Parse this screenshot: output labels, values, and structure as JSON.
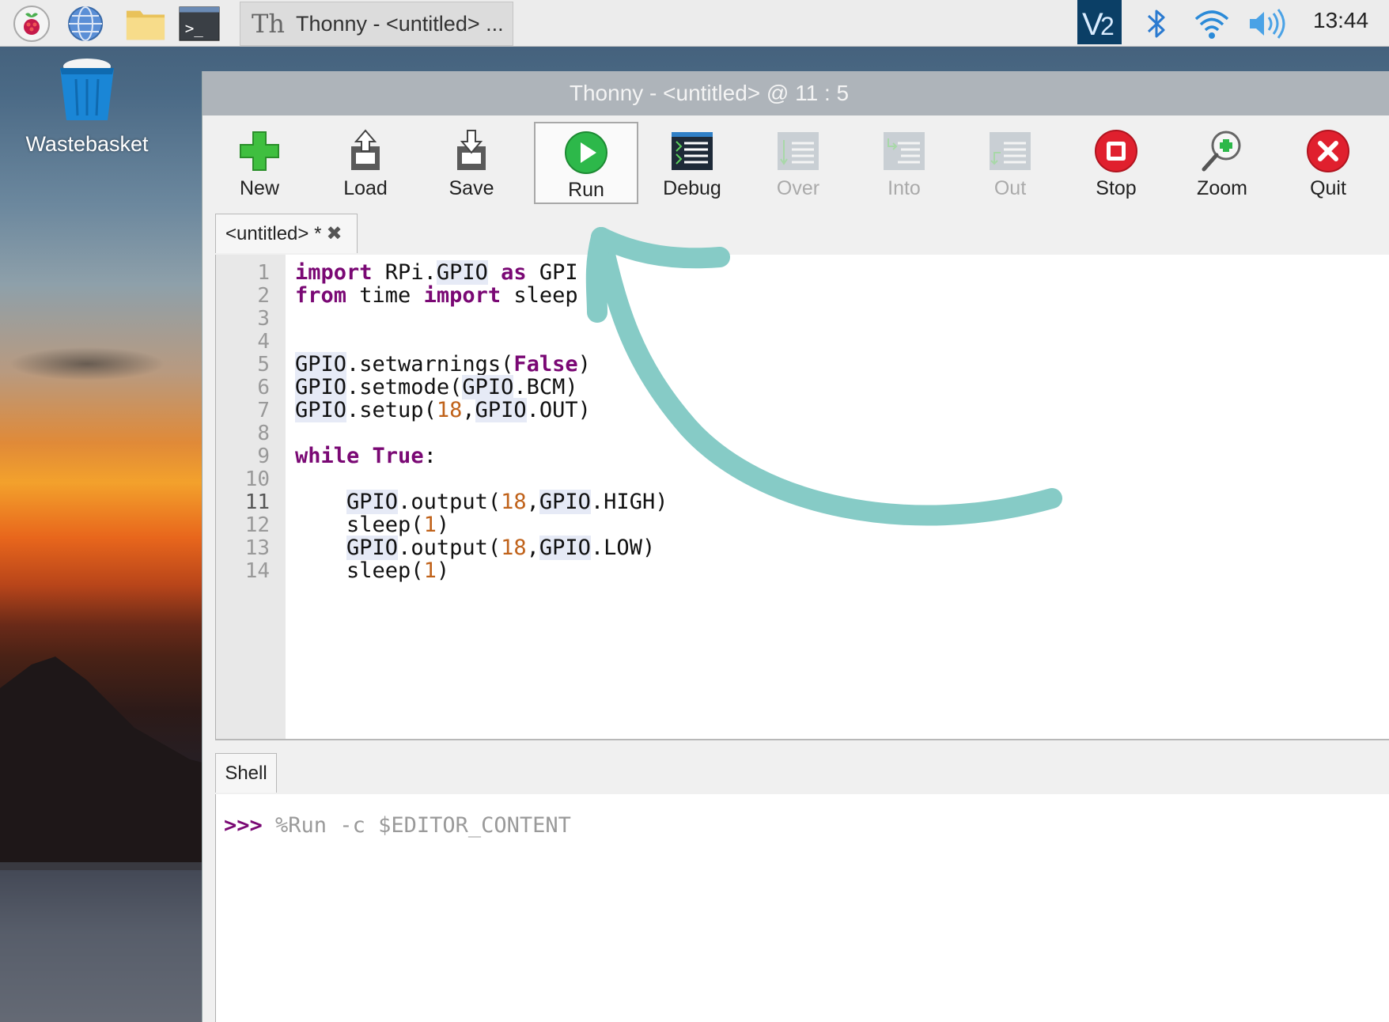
{
  "panel": {
    "task_title": "Thonny  -  <untitled>  ...",
    "clock": "13:44",
    "vnc_label": "V2"
  },
  "desktop": {
    "wastebasket_label": "Wastebasket"
  },
  "window": {
    "title": "Thonny  -  <untitled>  @  11 : 5"
  },
  "toolbar": {
    "new": "New",
    "load": "Load",
    "save": "Save",
    "run": "Run",
    "debug": "Debug",
    "over": "Over",
    "into": "Into",
    "out": "Out",
    "stop": "Stop",
    "zoom": "Zoom",
    "quit": "Quit"
  },
  "editor": {
    "tab_label": "<untitled> *",
    "line_numbers": [
      "1",
      "2",
      "3",
      "4",
      "5",
      "6",
      "7",
      "8",
      "9",
      "10",
      "11",
      "12",
      "13",
      "14"
    ],
    "line1": {
      "kw1": "import",
      "t1": " RPi.",
      "g": "GPIO",
      "t2": " ",
      "kw2": "as",
      "t3": " GPI"
    },
    "line2": {
      "kw1": "from",
      "t1": " time ",
      "kw2": "import",
      "t2": " sleep"
    },
    "line5": {
      "g": "GPIO",
      "t1": ".setwarnings(",
      "kw": "False",
      "t2": ")"
    },
    "line6": {
      "g1": "GPIO",
      "t1": ".setmode(",
      "g2": "GPIO",
      "t2": ".BCM)"
    },
    "line7": {
      "g1": "GPIO",
      "t1": ".setup(",
      "n": "18",
      "t2": ",",
      "g2": "GPIO",
      "t3": ".OUT)"
    },
    "line9": {
      "kw1": "while",
      "t1": " ",
      "kw2": "True",
      "t2": ":"
    },
    "line11": {
      "indent": "    ",
      "g1": "GPIO",
      "t1": ".output(",
      "n": "18",
      "t2": ",",
      "g2": "GPIO",
      "t3": ".HIGH)"
    },
    "line12": {
      "indent": "    ",
      "t1": "sleep(",
      "n": "1",
      "t2": ")"
    },
    "line13": {
      "indent": "    ",
      "g1": "GPIO",
      "t1": ".output(",
      "n": "18",
      "t2": ",",
      "g2": "GPIO",
      "t3": ".LOW)"
    },
    "line14": {
      "indent": "    ",
      "t1": "sleep(",
      "n": "1",
      "t2": ")"
    }
  },
  "shell": {
    "tab_label": "Shell",
    "prompt": ">>> ",
    "command": "%Run -c $EDITOR_CONTENT"
  },
  "colors": {
    "keyword": "#7a0874",
    "number": "#c0621a",
    "arrow": "#86cbc6",
    "run_green": "#2db84a",
    "stop_red": "#e0202e"
  }
}
